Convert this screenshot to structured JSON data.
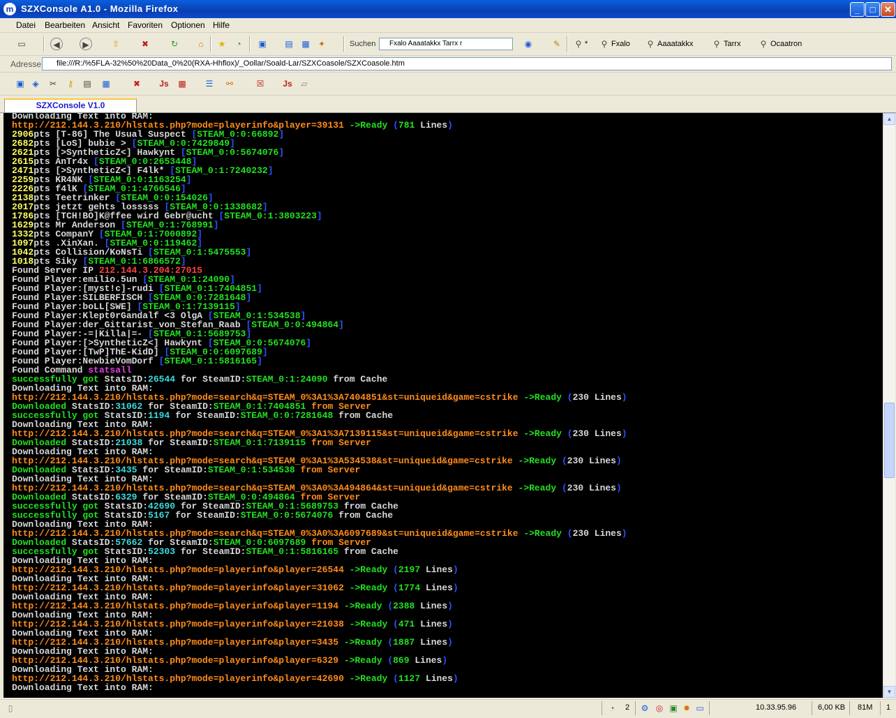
{
  "window": {
    "title": "SZXConsole A1.0 - Mozilla Firefox",
    "minimize": "_",
    "maximize": "□",
    "close": "✕"
  },
  "menu": {
    "items": [
      "Datei",
      "Bearbeiten",
      "Ansicht",
      "Favoriten",
      "Optionen",
      "Hilfe"
    ]
  },
  "toolbar": {
    "search_label": "Suchen",
    "search_value": "Fxalo Aaaatakkx Tarrx r",
    "find_links": [
      "*",
      "Fxalo",
      "Aaaatakkx",
      "Tarrx",
      "Ocaatron"
    ]
  },
  "address": {
    "label": "Adresse",
    "url": "file:///R:/%5FLA-32%50%20Data_0%20(RXA-Hhflox)/_Oollar/Soald-Lar/SZXCoasole/SZXCoasole.htm"
  },
  "tab": {
    "label": "SZXConsole V1.0"
  },
  "status": {
    "count": "2",
    "time": "10.33.95.96",
    "size": "6,00 KB",
    "mem": "81M",
    "page": "1"
  },
  "console_lines": [
    [
      [
        "w",
        "Downloading Text into RAM:"
      ]
    ],
    [
      [
        "o",
        "http://212.144.3.210/hlstats.php?mode=playerinfo&player=39131 "
      ],
      [
        "g",
        "->Ready "
      ],
      [
        "b",
        "("
      ],
      [
        "g",
        "781 "
      ],
      [
        "w",
        "Lines"
      ],
      [
        "b",
        ")"
      ]
    ],
    [
      [
        "y",
        "2906"
      ],
      [
        "w",
        "pts [T-86] The Usual Suspect "
      ],
      [
        "b",
        "["
      ],
      [
        "g",
        "STEAM_0:0:66892"
      ],
      [
        "b",
        "]"
      ]
    ],
    [
      [
        "y",
        "2682"
      ],
      [
        "w",
        "pts [LoS] bubie > "
      ],
      [
        "b",
        "["
      ],
      [
        "g",
        "STEAM_0:0:7429849"
      ],
      [
        "b",
        "]"
      ]
    ],
    [
      [
        "y",
        "2621"
      ],
      [
        "w",
        "pts [>SyntheticZ<] Hawkynt "
      ],
      [
        "b",
        "["
      ],
      [
        "g",
        "STEAM_0:0:5674076"
      ],
      [
        "b",
        "]"
      ]
    ],
    [
      [
        "y",
        "2615"
      ],
      [
        "w",
        "pts AnTr4x "
      ],
      [
        "b",
        "["
      ],
      [
        "g",
        "STEAM_0:0:2653448"
      ],
      [
        "b",
        "]"
      ]
    ],
    [
      [
        "y",
        "2471"
      ],
      [
        "w",
        "pts [>SyntheticZ<] F4lk* "
      ],
      [
        "b",
        "["
      ],
      [
        "g",
        "STEAM_0:1:7240232"
      ],
      [
        "b",
        "]"
      ]
    ],
    [
      [
        "y",
        "2259"
      ],
      [
        "w",
        "pts KR4NK "
      ],
      [
        "b",
        "["
      ],
      [
        "g",
        "STEAM_0:0:1163254"
      ],
      [
        "b",
        "]"
      ]
    ],
    [
      [
        "y",
        "2226"
      ],
      [
        "w",
        "pts f4lK "
      ],
      [
        "b",
        "["
      ],
      [
        "g",
        "STEAM_0:1:4766546"
      ],
      [
        "b",
        "]"
      ]
    ],
    [
      [
        "y",
        "2138"
      ],
      [
        "w",
        "pts Teetrinker "
      ],
      [
        "b",
        "["
      ],
      [
        "g",
        "STEAM_0:0:154026"
      ],
      [
        "b",
        "]"
      ]
    ],
    [
      [
        "y",
        "2017"
      ],
      [
        "w",
        "pts jetzt gehts losssss "
      ],
      [
        "b",
        "["
      ],
      [
        "g",
        "STEAM_0:0:1338682"
      ],
      [
        "b",
        "]"
      ]
    ],
    [
      [
        "y",
        "1786"
      ],
      [
        "w",
        "pts [TCH!BO]K@ffee wird Gebr@ucht "
      ],
      [
        "b",
        "["
      ],
      [
        "g",
        "STEAM_0:1:3803223"
      ],
      [
        "b",
        "]"
      ]
    ],
    [
      [
        "y",
        "1629"
      ],
      [
        "w",
        "pts Mr Anderson "
      ],
      [
        "b",
        "["
      ],
      [
        "g",
        "STEAM_0:1:768991"
      ],
      [
        "b",
        "]"
      ]
    ],
    [
      [
        "y",
        "1332"
      ],
      [
        "w",
        "pts CompanY "
      ],
      [
        "b",
        "["
      ],
      [
        "g",
        "STEAM_0:1:7000892"
      ],
      [
        "b",
        "]"
      ]
    ],
    [
      [
        "y",
        "1097"
      ],
      [
        "w",
        "pts .XinXan. "
      ],
      [
        "b",
        "["
      ],
      [
        "g",
        "STEAM_0:0:119462"
      ],
      [
        "b",
        "]"
      ]
    ],
    [
      [
        "y",
        "1042"
      ],
      [
        "w",
        "pts Collision/KoNsTi "
      ],
      [
        "b",
        "["
      ],
      [
        "g",
        "STEAM_0:1:5475553"
      ],
      [
        "b",
        "]"
      ]
    ],
    [
      [
        "y",
        "1018"
      ],
      [
        "w",
        "pts Siky "
      ],
      [
        "b",
        "["
      ],
      [
        "g",
        "STEAM_0:1:6866572"
      ],
      [
        "b",
        "]"
      ]
    ],
    [
      [
        "w",
        "Found Server IP "
      ],
      [
        "r",
        "212.144.3.204:27015"
      ]
    ],
    [
      [
        "w",
        "Found Player:emilio.5un "
      ],
      [
        "b",
        "["
      ],
      [
        "g",
        "STEAM_0:1:24090"
      ],
      [
        "b",
        "]"
      ]
    ],
    [
      [
        "w",
        "Found Player:[myst!c]-rudi "
      ],
      [
        "b",
        "["
      ],
      [
        "g",
        "STEAM_0:1:7404851"
      ],
      [
        "b",
        "]"
      ]
    ],
    [
      [
        "w",
        "Found Player:SILBERFISCH "
      ],
      [
        "b",
        "["
      ],
      [
        "g",
        "STEAM_0:0:7281648"
      ],
      [
        "b",
        "]"
      ]
    ],
    [
      [
        "w",
        "Found Player:boLL[SWE] "
      ],
      [
        "b",
        "["
      ],
      [
        "g",
        "STEAM_0:1:7139115"
      ],
      [
        "b",
        "]"
      ]
    ],
    [
      [
        "w",
        "Found Player:Klept0rGandalf <3 OlgA "
      ],
      [
        "b",
        "["
      ],
      [
        "g",
        "STEAM_0:1:534538"
      ],
      [
        "b",
        "]"
      ]
    ],
    [
      [
        "w",
        "Found Player:der_Gittarist_von_Stefan_Raab "
      ],
      [
        "b",
        "["
      ],
      [
        "g",
        "STEAM_0:0:494864"
      ],
      [
        "b",
        "]"
      ]
    ],
    [
      [
        "w",
        "Found Player:-=|Killa|=- "
      ],
      [
        "b",
        "["
      ],
      [
        "g",
        "STEAM_0:1:5689753"
      ],
      [
        "b",
        "]"
      ]
    ],
    [
      [
        "w",
        "Found Player:[>SyntheticZ<] Hawkynt "
      ],
      [
        "b",
        "["
      ],
      [
        "g",
        "STEAM_0:0:5674076"
      ],
      [
        "b",
        "]"
      ]
    ],
    [
      [
        "w",
        "Found Player:[TwP]ThE-KidD] "
      ],
      [
        "b",
        "["
      ],
      [
        "g",
        "STEAM_0:0:6097689"
      ],
      [
        "b",
        "]"
      ]
    ],
    [
      [
        "w",
        "Found Player:NewbieVomDorf "
      ],
      [
        "b",
        "["
      ],
      [
        "g",
        "STEAM_0:1:5816165"
      ],
      [
        "b",
        "]"
      ]
    ],
    [
      [
        "w",
        "Found Command "
      ],
      [
        "m",
        "statsall"
      ]
    ],
    [
      [
        "g",
        "successfully got "
      ],
      [
        "w",
        "StatsID:"
      ],
      [
        "c",
        "26544 "
      ],
      [
        "w",
        "for SteamID:"
      ],
      [
        "g",
        "STEAM_0:1:24090 "
      ],
      [
        "w",
        "from Cache"
      ]
    ],
    [
      [
        "w",
        "Downloading Text into RAM:"
      ]
    ],
    [
      [
        "o",
        "http://212.144.3.210/hlstats.php?mode=search&q=STEAM_0%3A1%3A7404851&st=uniqueid&game=cstrike "
      ],
      [
        "g",
        "->Ready "
      ],
      [
        "b",
        "("
      ],
      [
        "w",
        "230 Lines"
      ],
      [
        "b",
        ")"
      ]
    ],
    [
      [
        "g",
        "Downloaded "
      ],
      [
        "w",
        "StatsID:"
      ],
      [
        "c",
        "31062 "
      ],
      [
        "w",
        "for SteamID:"
      ],
      [
        "g",
        "STEAM_0:1:7404851 "
      ],
      [
        "o",
        "from Server"
      ]
    ],
    [
      [
        "g",
        "successfully got "
      ],
      [
        "w",
        "StatsID:"
      ],
      [
        "c",
        "1194 "
      ],
      [
        "w",
        "for SteamID:"
      ],
      [
        "g",
        "STEAM_0:0:7281648 "
      ],
      [
        "w",
        "from Cache"
      ]
    ],
    [
      [
        "w",
        "Downloading Text into RAM:"
      ]
    ],
    [
      [
        "o",
        "http://212.144.3.210/hlstats.php?mode=search&q=STEAM_0%3A1%3A7139115&st=uniqueid&game=cstrike "
      ],
      [
        "g",
        "->Ready "
      ],
      [
        "b",
        "("
      ],
      [
        "w",
        "230 Lines"
      ],
      [
        "b",
        ")"
      ]
    ],
    [
      [
        "g",
        "Downloaded "
      ],
      [
        "w",
        "StatsID:"
      ],
      [
        "c",
        "21038 "
      ],
      [
        "w",
        "for SteamID:"
      ],
      [
        "g",
        "STEAM_0:1:7139115 "
      ],
      [
        "o",
        "from Server"
      ]
    ],
    [
      [
        "w",
        "Downloading Text into RAM:"
      ]
    ],
    [
      [
        "o",
        "http://212.144.3.210/hlstats.php?mode=search&q=STEAM_0%3A1%3A534538&st=uniqueid&game=cstrike "
      ],
      [
        "g",
        "->Ready "
      ],
      [
        "b",
        "("
      ],
      [
        "w",
        "230 Lines"
      ],
      [
        "b",
        ")"
      ]
    ],
    [
      [
        "g",
        "Downloaded "
      ],
      [
        "w",
        "StatsID:"
      ],
      [
        "c",
        "3435 "
      ],
      [
        "w",
        "for SteamID:"
      ],
      [
        "g",
        "STEAM_0:1:534538 "
      ],
      [
        "o",
        "from Server"
      ]
    ],
    [
      [
        "w",
        "Downloading Text into RAM:"
      ]
    ],
    [
      [
        "o",
        "http://212.144.3.210/hlstats.php?mode=search&q=STEAM_0%3A0%3A494864&st=uniqueid&game=cstrike "
      ],
      [
        "g",
        "->Ready "
      ],
      [
        "b",
        "("
      ],
      [
        "w",
        "230 Lines"
      ],
      [
        "b",
        ")"
      ]
    ],
    [
      [
        "g",
        "Downloaded "
      ],
      [
        "w",
        "StatsID:"
      ],
      [
        "c",
        "6329 "
      ],
      [
        "w",
        "for SteamID:"
      ],
      [
        "g",
        "STEAM_0:0:494864 "
      ],
      [
        "o",
        "from Server"
      ]
    ],
    [
      [
        "g",
        "successfully got "
      ],
      [
        "w",
        "StatsID:"
      ],
      [
        "c",
        "42690 "
      ],
      [
        "w",
        "for SteamID:"
      ],
      [
        "g",
        "STEAM_0:1:5689753 "
      ],
      [
        "w",
        "from Cache"
      ]
    ],
    [
      [
        "g",
        "successfully got "
      ],
      [
        "w",
        "StatsID:"
      ],
      [
        "c",
        "5167 "
      ],
      [
        "w",
        "for SteamID:"
      ],
      [
        "g",
        "STEAM_0:0:5674076 "
      ],
      [
        "w",
        "from Cache"
      ]
    ],
    [
      [
        "w",
        "Downloading Text into RAM:"
      ]
    ],
    [
      [
        "o",
        "http://212.144.3.210/hlstats.php?mode=search&q=STEAM_0%3A0%3A6097689&st=uniqueid&game=cstrike "
      ],
      [
        "g",
        "->Ready "
      ],
      [
        "b",
        "("
      ],
      [
        "w",
        "230 Lines"
      ],
      [
        "b",
        ")"
      ]
    ],
    [
      [
        "g",
        "Downloaded "
      ],
      [
        "w",
        "StatsID:"
      ],
      [
        "c",
        "57662 "
      ],
      [
        "w",
        "for SteamID:"
      ],
      [
        "g",
        "STEAM_0:0:6097689 "
      ],
      [
        "o",
        "from Server"
      ]
    ],
    [
      [
        "g",
        "successfully got "
      ],
      [
        "w",
        "StatsID:"
      ],
      [
        "c",
        "52303 "
      ],
      [
        "w",
        "for SteamID:"
      ],
      [
        "g",
        "STEAM_0:1:5816165 "
      ],
      [
        "w",
        "from Cache"
      ]
    ],
    [
      [
        "w",
        "Downloading Text into RAM:"
      ]
    ],
    [
      [
        "o",
        "http://212.144.3.210/hlstats.php?mode=playerinfo&player=26544 "
      ],
      [
        "g",
        "->Ready "
      ],
      [
        "b",
        "("
      ],
      [
        "g",
        "2197 "
      ],
      [
        "w",
        "Lines"
      ],
      [
        "b",
        ")"
      ]
    ],
    [
      [
        "w",
        "Downloading Text into RAM:"
      ]
    ],
    [
      [
        "o",
        "http://212.144.3.210/hlstats.php?mode=playerinfo&player=31062 "
      ],
      [
        "g",
        "->Ready "
      ],
      [
        "b",
        "("
      ],
      [
        "g",
        "1774 "
      ],
      [
        "w",
        "Lines"
      ],
      [
        "b",
        ")"
      ]
    ],
    [
      [
        "w",
        "Downloading Text into RAM:"
      ]
    ],
    [
      [
        "o",
        "http://212.144.3.210/hlstats.php?mode=playerinfo&player=1194 "
      ],
      [
        "g",
        "->Ready "
      ],
      [
        "b",
        "("
      ],
      [
        "g",
        "2388 "
      ],
      [
        "w",
        "Lines"
      ],
      [
        "b",
        ")"
      ]
    ],
    [
      [
        "w",
        "Downloading Text into RAM:"
      ]
    ],
    [
      [
        "o",
        "http://212.144.3.210/hlstats.php?mode=playerinfo&player=21038 "
      ],
      [
        "g",
        "->Ready "
      ],
      [
        "b",
        "("
      ],
      [
        "g",
        "471 "
      ],
      [
        "w",
        "Lines"
      ],
      [
        "b",
        ")"
      ]
    ],
    [
      [
        "w",
        "Downloading Text into RAM:"
      ]
    ],
    [
      [
        "o",
        "http://212.144.3.210/hlstats.php?mode=playerinfo&player=3435 "
      ],
      [
        "g",
        "->Ready "
      ],
      [
        "b",
        "("
      ],
      [
        "g",
        "1887 "
      ],
      [
        "w",
        "Lines"
      ],
      [
        "b",
        ")"
      ]
    ],
    [
      [
        "w",
        "Downloading Text into RAM:"
      ]
    ],
    [
      [
        "o",
        "http://212.144.3.210/hlstats.php?mode=playerinfo&player=6329 "
      ],
      [
        "g",
        "->Ready "
      ],
      [
        "b",
        "("
      ],
      [
        "g",
        "869 "
      ],
      [
        "w",
        "Lines"
      ],
      [
        "b",
        ")"
      ]
    ],
    [
      [
        "w",
        "Downloading Text into RAM:"
      ]
    ],
    [
      [
        "o",
        "http://212.144.3.210/hlstats.php?mode=playerinfo&player=42690 "
      ],
      [
        "g",
        "->Ready "
      ],
      [
        "b",
        "("
      ],
      [
        "g",
        "1127 "
      ],
      [
        "w",
        "Lines"
      ],
      [
        "b",
        ")"
      ]
    ],
    [
      [
        "w",
        "Downloading Text into RAM:"
      ]
    ]
  ]
}
